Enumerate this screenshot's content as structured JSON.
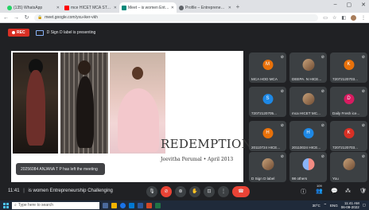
{
  "browser": {
    "tabs": [
      {
        "label": "(135) WhatsApp",
        "color": "#25d366",
        "active": false
      },
      {
        "label": "mce HICET MCA STAFF Live Stre...",
        "color": "#ff0000",
        "active": false
      },
      {
        "label": "Meet – is women Entrepren...",
        "color": "#00897b",
        "active": true
      },
      {
        "label": "Profile – Entrepreneurship – rec...",
        "color": "#5f6368",
        "active": false
      }
    ],
    "new_tab": "+",
    "url": "meet.google.com/yxu-iker-vkh"
  },
  "meeting": {
    "rec_label": "REC",
    "presenting_text": "D Sign D label is presenting",
    "slide": {
      "title": "REDEMPTION",
      "subtitle": "Jeevitha Perumal • April 2013"
    },
    "toast": "20256084 ANJANA T P has left the meeting",
    "time": "11:41",
    "separator": "|",
    "meeting_name": "is women Entrepreneurship Challenging",
    "people_count": "109"
  },
  "participants": [
    {
      "initial": "M",
      "name": "MCA HOD MCA",
      "color": "#e8710a",
      "type": "initial"
    },
    {
      "initial": "",
      "name": "DEEPA. N HICE...",
      "color": "",
      "type": "photo"
    },
    {
      "initial": "K",
      "name": "72072120703...",
      "color": "#e8710a",
      "type": "initial"
    },
    {
      "initial": "S",
      "name": "72072120705...",
      "color": "#1e88e5",
      "type": "initial"
    },
    {
      "initial": "",
      "name": "mca HICET MC...",
      "color": "",
      "type": "photo"
    },
    {
      "initial": "D",
      "name": "Daily Fresh ice...",
      "color": "#d81b60",
      "type": "initial"
    },
    {
      "initial": "H",
      "name": "20110724 HICE...",
      "color": "#e8710a",
      "type": "initial"
    },
    {
      "initial": "H",
      "name": "20110024 HICE...",
      "color": "#1e88e5",
      "type": "initial"
    },
    {
      "initial": "K",
      "name": "72072120703...",
      "color": "#d93025",
      "type": "initial"
    },
    {
      "initial": "",
      "name": "D Sign D label",
      "color": "",
      "type": "photo"
    },
    {
      "initial": "",
      "name": "98 others",
      "color": "",
      "type": "others"
    },
    {
      "initial": "",
      "name": "You",
      "color": "",
      "type": "photo"
    }
  ],
  "taskbar": {
    "search_placeholder": "Type here to search",
    "weather": "30°C",
    "lang": "ENG",
    "time": "11:41 AM",
    "date": "06-09-2022"
  }
}
